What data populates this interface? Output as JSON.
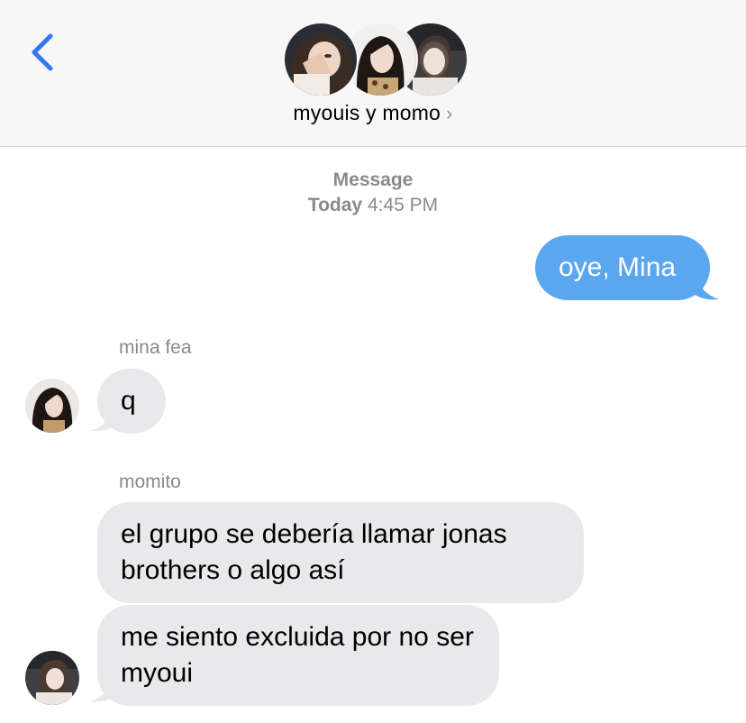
{
  "header": {
    "title": "myouis y momo",
    "chevron": "›",
    "back_icon": "chevron-left-icon",
    "accent": "#3478f6",
    "participants": [
      "avatar-photo-1",
      "avatar-photo-2",
      "avatar-photo-3"
    ]
  },
  "timestamp": {
    "service": "Message",
    "day": "Today",
    "time": "4:45 PM"
  },
  "messages": [
    {
      "direction": "outgoing",
      "text": "oye, Mina"
    },
    {
      "direction": "incoming",
      "sender": "mina fea",
      "text": "q"
    },
    {
      "direction": "incoming",
      "sender": "momito",
      "text": "el grupo se debería llamar jonas brothers o algo así"
    },
    {
      "direction": "incoming",
      "sender": "momito",
      "text": "me siento excluida por no ser myoui"
    }
  ],
  "colors": {
    "outgoing_bubble": "#5aa6ef",
    "incoming_bubble": "#e9e9eb",
    "secondary_text": "#8a8a8e"
  }
}
